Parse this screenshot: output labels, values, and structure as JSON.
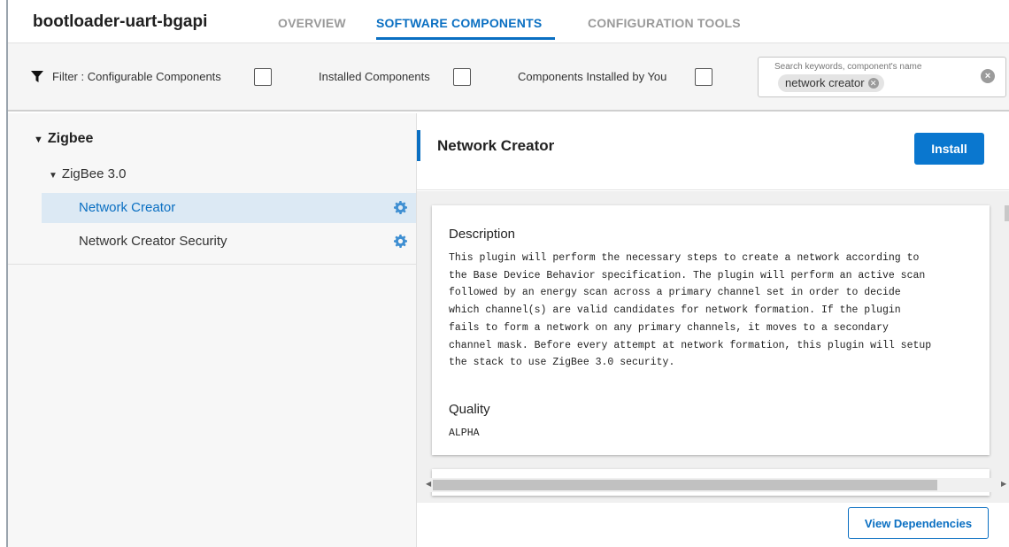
{
  "header": {
    "project_title": "bootloader-uart-bgapi",
    "tabs": [
      {
        "label": "OVERVIEW",
        "active": false
      },
      {
        "label": "SOFTWARE COMPONENTS",
        "active": true
      },
      {
        "label": "CONFIGURATION TOOLS",
        "active": false
      }
    ]
  },
  "filters": {
    "prefix": "Filter :",
    "configurable": "Configurable Components",
    "installed": "Installed Components",
    "installed_by_you": "Components Installed by You",
    "search": {
      "placeholder": "Search keywords, component's name",
      "chip": "network creator"
    }
  },
  "tree": {
    "root": "Zigbee",
    "child": "ZigBee 3.0",
    "items": [
      {
        "label": "Network Creator",
        "selected": true
      },
      {
        "label": "Network Creator Security",
        "selected": false
      }
    ]
  },
  "detail": {
    "title": "Network Creator",
    "install_label": "Install",
    "description_heading": "Description",
    "description_lines": [
      "This plugin will perform the necessary steps to create a network according to",
      "the Base Device Behavior specification. The plugin will perform an active scan",
      "followed by an energy scan across a primary channel set in order to decide",
      "which channel(s) are valid candidates for network formation. If the plugin",
      "fails to form a network on any primary channels, it moves to a secondary",
      "channel mask. Before every attempt at network formation, this plugin will setup",
      "the stack to use ZigBee 3.0 security."
    ],
    "quality_heading": "Quality",
    "quality_value": "ALPHA",
    "view_dependencies_label": "View Dependencies"
  },
  "colors": {
    "accent": "#0a6fc2",
    "selected_row": "#dce9f4"
  },
  "icons": [
    "filter-icon",
    "checkbox",
    "close-circle-icon",
    "caret-down-icon",
    "gear-icon"
  ]
}
